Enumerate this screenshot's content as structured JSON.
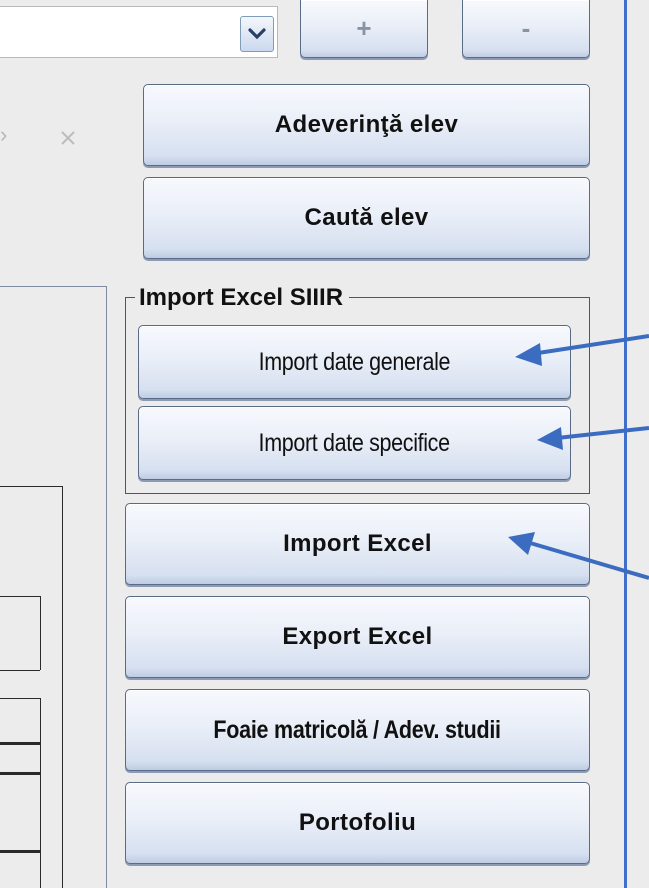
{
  "toolbar": {
    "add_label": "+",
    "remove_label": "-"
  },
  "icons": {
    "dropdown": "chevron-down-icon",
    "close": "close-icon"
  },
  "buttons": {
    "adeverinta_elev": "Adeverinţă elev",
    "cauta_elev": "Caută elev",
    "import_excel": "Import Excel",
    "export_excel": "Export Excel",
    "foaie_matricola": "Foaie matricolă / Adev. studii",
    "portofoliu": "Portofoliu"
  },
  "import_siiir": {
    "group_title": "Import Excel SIIIR",
    "import_date_generale": "Import date generale",
    "import_date_specifice": "Import date specifice"
  },
  "colors": {
    "arrow": "#3b6cc0",
    "divider": "#3f6fc8",
    "button_border": "#5a6b85"
  }
}
